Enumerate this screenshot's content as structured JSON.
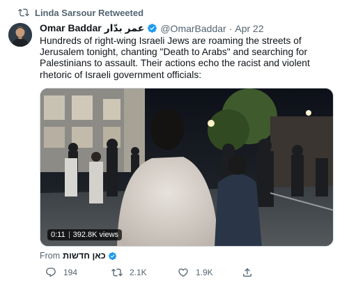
{
  "retweet_context": {
    "label": "Linda Sarsour Retweeted",
    "icon": "retweet-icon"
  },
  "tweet": {
    "author_name": "Omar Baddar عمر بدّار",
    "author_handle": "@OmarBaddar",
    "separator": "·",
    "date": "Apr 22",
    "verified_icon": "verified-badge-icon",
    "text": "Hundreds of right-wing Israeli Jews are roaming the streets of Jerusalem tonight, chanting \"Death to Arabs\" and searching for Palestinians to assault. Their actions echo the racist and violent rhetoric of Israeli government officials:"
  },
  "media": {
    "type": "video",
    "time": "0:11",
    "views": "392.8K views"
  },
  "source": {
    "prefix": "From",
    "name": "כאן חדשות"
  },
  "actions": {
    "reply_count": "194",
    "retweet_count": "2.1K",
    "like_count": "1.9K"
  },
  "colors": {
    "text_primary": "#0f1419",
    "text_secondary": "#536471",
    "verified_blue": "#1d9bf0",
    "border": "#cfd9de"
  }
}
